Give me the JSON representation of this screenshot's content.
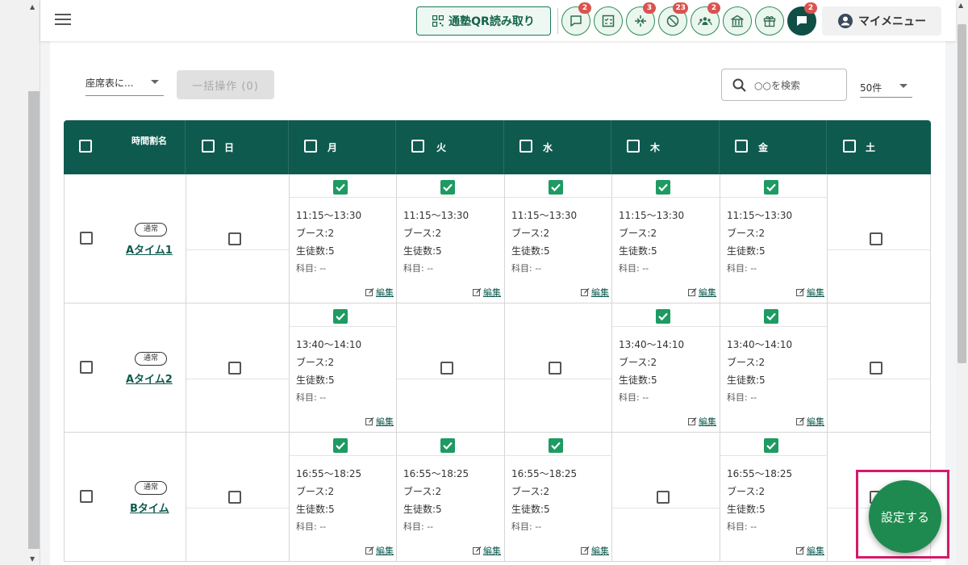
{
  "header": {
    "qr_button_label": "通塾QR読み取り",
    "icons": [
      {
        "name": "chat-icon",
        "badge": "2"
      },
      {
        "name": "checklist-icon",
        "badge": ""
      },
      {
        "name": "transfer-icon",
        "badge": "3"
      },
      {
        "name": "absence-icon",
        "badge": "23"
      },
      {
        "name": "group-icon",
        "badge": "2"
      },
      {
        "name": "school-icon",
        "badge": ""
      },
      {
        "name": "gift-icon",
        "badge": ""
      },
      {
        "name": "message-icon",
        "badge": "2"
      }
    ],
    "my_menu_label": "マイメニュー"
  },
  "toolbar": {
    "select_value": "座席表に...",
    "bulk_button_label": "一括操作 (0)",
    "search_placeholder": "○○を検索",
    "per_page_value": "50件"
  },
  "table": {
    "headers": {
      "timeslot": "時間割名",
      "days": [
        "日",
        "月",
        "火",
        "水",
        "木",
        "金",
        "土"
      ]
    },
    "rows": [
      {
        "type_badge": "通常",
        "name": "Aタイム1",
        "slots": [
          null,
          {
            "time": "11:15〜13:30",
            "booth": "ブース:2",
            "students": "生徒数:5",
            "subject": "科目: --",
            "edit": "編集"
          },
          {
            "time": "11:15〜13:30",
            "booth": "ブース:2",
            "students": "生徒数:5",
            "subject": "科目: --",
            "edit": "編集"
          },
          {
            "time": "11:15〜13:30",
            "booth": "ブース:2",
            "students": "生徒数:5",
            "subject": "科目: --",
            "edit": "編集"
          },
          {
            "time": "11:15〜13:30",
            "booth": "ブース:2",
            "students": "生徒数:5",
            "subject": "科目: --",
            "edit": "編集"
          },
          {
            "time": "11:15〜13:30",
            "booth": "ブース:2",
            "students": "生徒数:5",
            "subject": "科目: --",
            "edit": "編集"
          },
          null
        ]
      },
      {
        "type_badge": "通常",
        "name": "Aタイム2",
        "slots": [
          null,
          {
            "time": "13:40〜14:10",
            "booth": "ブース:2",
            "students": "生徒数:5",
            "subject": "科目: --",
            "edit": "編集"
          },
          null,
          null,
          {
            "time": "13:40〜14:10",
            "booth": "ブース:2",
            "students": "生徒数:5",
            "subject": "科目: --",
            "edit": "編集"
          },
          {
            "time": "13:40〜14:10",
            "booth": "ブース:2",
            "students": "生徒数:5",
            "subject": "科目: --",
            "edit": "編集"
          },
          null
        ]
      },
      {
        "type_badge": "通常",
        "name": "Bタイム",
        "slots": [
          null,
          {
            "time": "16:55〜18:25",
            "booth": "ブース:2",
            "students": "生徒数:5",
            "subject": "科目: --",
            "edit": "編集"
          },
          {
            "time": "16:55〜18:25",
            "booth": "ブース:2",
            "students": "生徒数:5",
            "subject": "科目: --",
            "edit": "編集"
          },
          {
            "time": "16:55〜18:25",
            "booth": "ブース:2",
            "students": "生徒数:5",
            "subject": "科目: --",
            "edit": "編集"
          },
          null,
          {
            "time": "16:55〜18:25",
            "booth": "ブース:2",
            "students": "生徒数:5",
            "subject": "科目: --",
            "edit": "編集"
          },
          null
        ]
      }
    ]
  },
  "fab": {
    "label": "設定する"
  },
  "colors": {
    "primary": "#0f5a4f",
    "accent": "#1f8a4f",
    "check": "#1e9a63",
    "badge": "#d9534f",
    "highlight": "#d6196b"
  }
}
